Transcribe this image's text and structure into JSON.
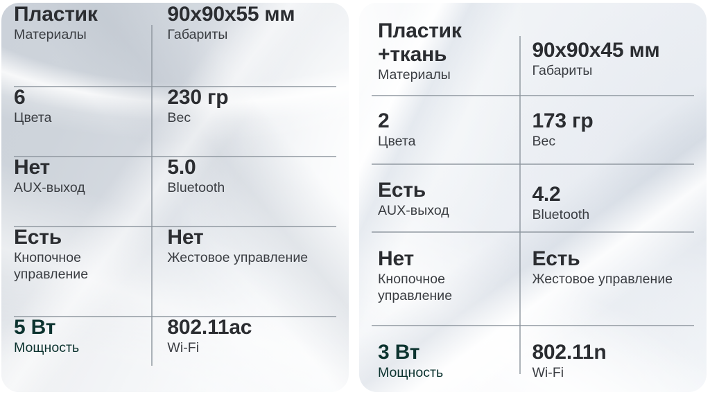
{
  "accent_color": "#0c332f",
  "value_color": "#2b2d31",
  "label_color": "#3a3d42",
  "divider_color": "#8e959e",
  "cards": [
    {
      "id": "speaker-left",
      "rows": [
        {
          "left": {
            "value": "Пластик",
            "label": "Материалы",
            "accent": false,
            "offset": 0
          },
          "right": {
            "value": "90x90x55 мм",
            "label": "Габариты",
            "accent": false,
            "offset": 0
          }
        },
        {
          "left": {
            "value": "6",
            "label": "Цвета",
            "accent": false,
            "offset": 0
          },
          "right": {
            "value": "230 гр",
            "label": "Вес",
            "accent": false,
            "offset": 0
          }
        },
        {
          "left": {
            "value": "Нет",
            "label": "AUX-выход",
            "accent": false,
            "offset": 0
          },
          "right": {
            "value": "5.0",
            "label": "Bluetooth",
            "accent": false,
            "offset": 0
          }
        },
        {
          "left": {
            "value": "Есть",
            "label": "Кнопочное управление",
            "accent": false,
            "offset": 0
          },
          "right": {
            "value": "Нет",
            "label": "Жестовое управление",
            "accent": false,
            "offset": 0
          }
        },
        {
          "left": {
            "value": "5 Вт",
            "label": "Мощность",
            "accent": true,
            "offset": 0
          },
          "right": {
            "value": "802.11ac",
            "label": "Wi-Fi",
            "accent": false,
            "offset": 0
          }
        }
      ]
    },
    {
      "id": "speaker-right",
      "rows": [
        {
          "left": {
            "value": "Пластик\n+ткань",
            "label": "Материалы",
            "accent": false,
            "offset": 0
          },
          "right": {
            "value": "90x90x45 мм",
            "label": "Габариты",
            "accent": false,
            "offset": 28
          }
        },
        {
          "left": {
            "value": "2",
            "label": "Цвета",
            "accent": false,
            "offset": 0
          },
          "right": {
            "value": "173 гр",
            "label": "Вес",
            "accent": false,
            "offset": 0
          }
        },
        {
          "left": {
            "value": "Есть",
            "label": "AUX-выход",
            "accent": false,
            "offset": 0
          },
          "right": {
            "value": "4.2",
            "label": "Bluetooth",
            "accent": false,
            "offset": 6
          }
        },
        {
          "left": {
            "value": "Нет",
            "label": "Кнопочное управление",
            "accent": false,
            "offset": 0
          },
          "right": {
            "value": "Есть",
            "label": "Жестовое управление",
            "accent": false,
            "offset": 0
          }
        },
        {
          "left": {
            "value": "3 Вт",
            "label": "Мощность",
            "accent": true,
            "offset": 0
          },
          "right": {
            "value": "802.11n",
            "label": "Wi-Fi",
            "accent": false,
            "offset": 0
          }
        }
      ]
    }
  ]
}
